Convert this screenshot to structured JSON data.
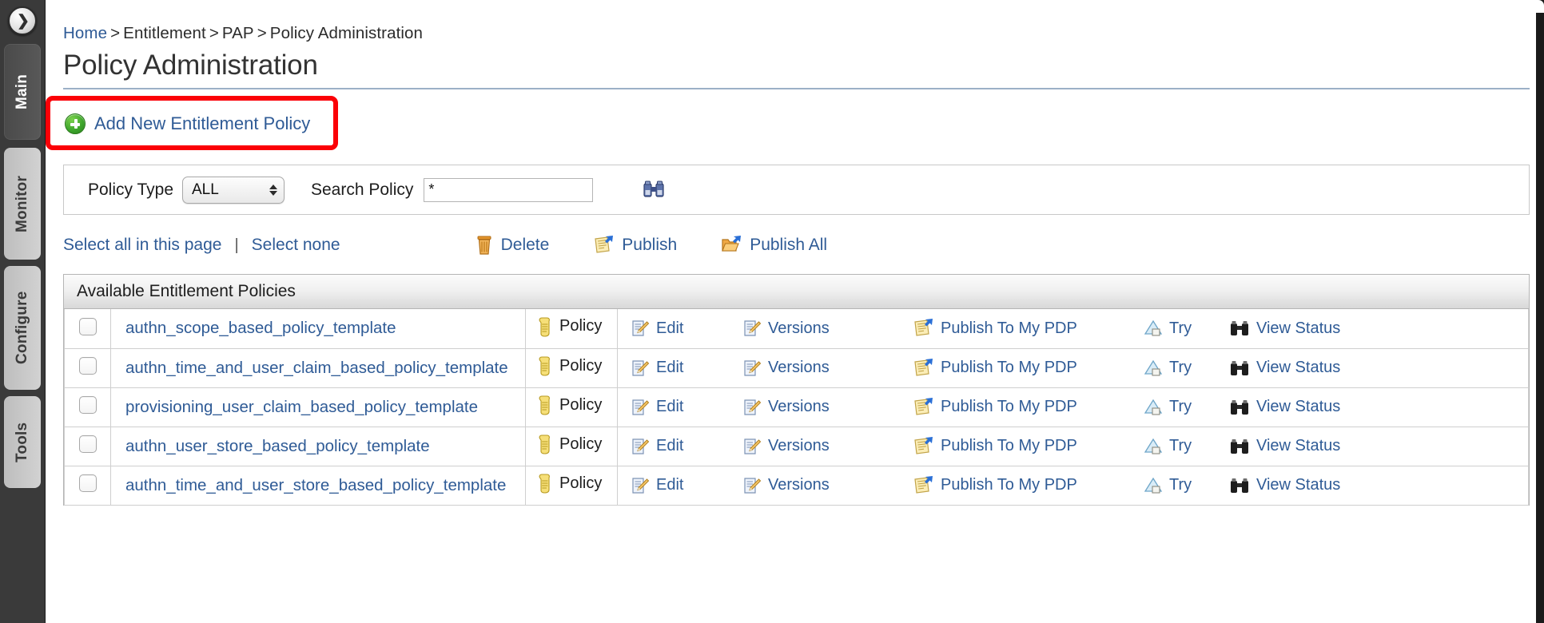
{
  "sidebar": {
    "toggle_icon": "chevron-right-icon",
    "tabs": [
      {
        "label": "Main",
        "active": true
      },
      {
        "label": "Monitor",
        "active": false
      },
      {
        "label": "Configure",
        "active": false
      },
      {
        "label": "Tools",
        "active": false
      }
    ]
  },
  "breadcrumb": {
    "items": [
      "Home",
      "Entitlement",
      "PAP",
      "Policy Administration"
    ],
    "separator": ">"
  },
  "page": {
    "title": "Policy Administration"
  },
  "add_policy": {
    "label": "Add New Entitlement Policy",
    "icon": "green-plus-icon",
    "highlight_color": "#fb0007"
  },
  "filter": {
    "policy_type_label": "Policy Type",
    "policy_type_value": "ALL",
    "policy_type_options": [
      "ALL"
    ],
    "search_label": "Search Policy",
    "search_value": "*",
    "search_placeholder": "*",
    "search_icon": "binoculars-icon"
  },
  "selection": {
    "select_all_label": "Select all in this page",
    "divider": "|",
    "select_none_label": "Select none"
  },
  "bulk_actions": [
    {
      "label": "Delete",
      "icon": "trash-icon"
    },
    {
      "label": "Publish",
      "icon": "publish-document-icon"
    },
    {
      "label": "Publish All",
      "icon": "publish-folder-icon"
    }
  ],
  "table": {
    "caption": "Available Entitlement Policies",
    "row_actions": [
      {
        "label": "Edit",
        "icon": "edit-document-icon"
      },
      {
        "label": "Versions",
        "icon": "versions-document-icon"
      },
      {
        "label": "Publish To My PDP",
        "icon": "publish-document-icon"
      },
      {
        "label": "Try",
        "icon": "try-arrow-icon"
      },
      {
        "label": "View Status",
        "icon": "binoculars-dark-icon"
      }
    ],
    "rows": [
      {
        "name": "authn_scope_based_policy_template",
        "type": "Policy",
        "type_icon": "policy-scroll-icon",
        "checked": false
      },
      {
        "name": "authn_time_and_user_claim_based_policy_template",
        "type": "Policy",
        "type_icon": "policy-scroll-icon",
        "checked": false
      },
      {
        "name": "provisioning_user_claim_based_policy_template",
        "type": "Policy",
        "type_icon": "policy-scroll-icon",
        "checked": false
      },
      {
        "name": "authn_user_store_based_policy_template",
        "type": "Policy",
        "type_icon": "policy-scroll-icon",
        "checked": false
      },
      {
        "name": "authn_time_and_user_store_based_policy_template",
        "type": "Policy",
        "type_icon": "policy-scroll-icon",
        "checked": false
      }
    ]
  },
  "colors": {
    "link": "#2f5b96",
    "accent_rule": "#9cb0c7",
    "highlight": "#fb0007",
    "sidebar_bg": "#3a3a3a"
  }
}
